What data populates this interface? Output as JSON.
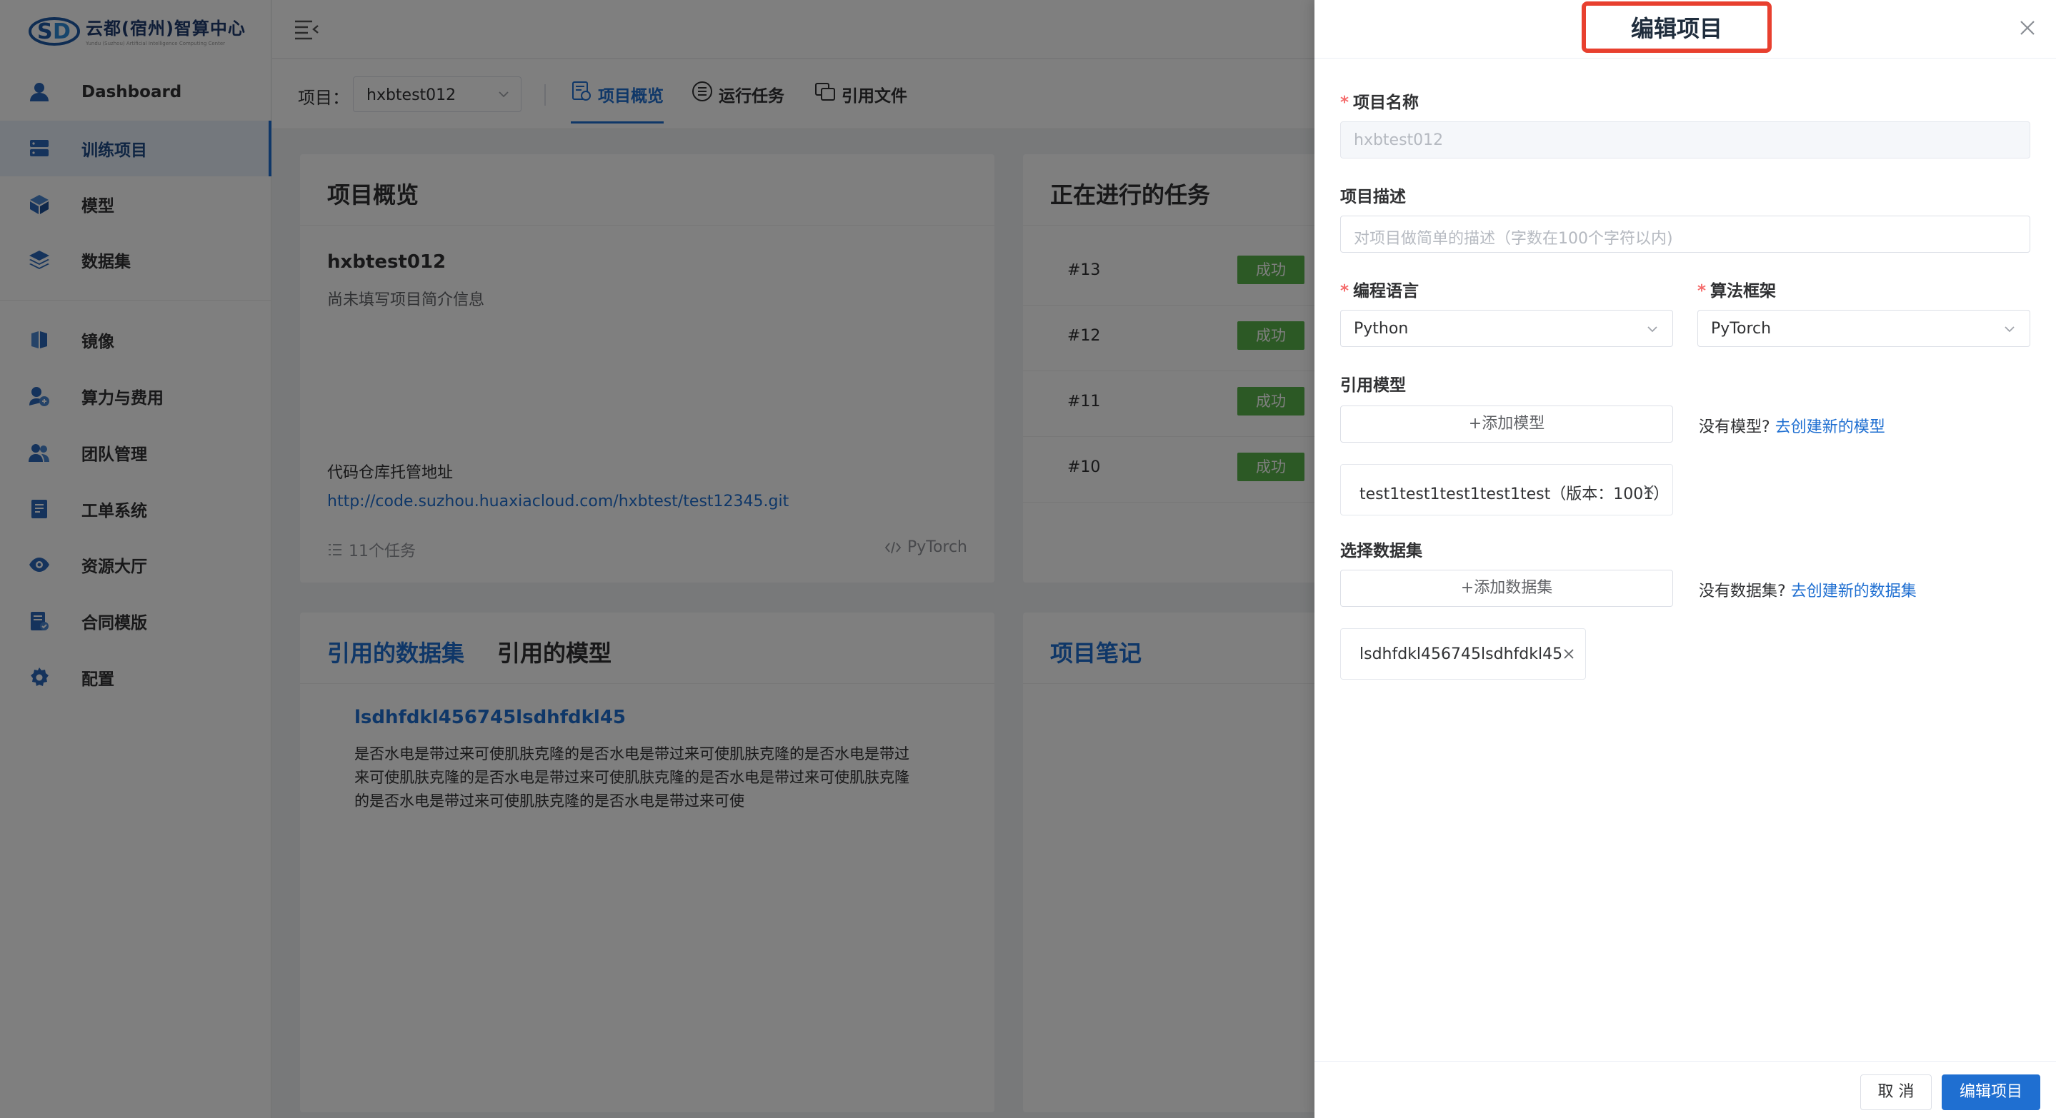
{
  "brand": {
    "title": "云都(宿州)智算中心",
    "subtitle": "Yundu (Suzhou) Artificial Intelligence Computing Center"
  },
  "sidebar": {
    "items": [
      {
        "label": "Dashboard",
        "icon": "user-icon"
      },
      {
        "label": "训练项目",
        "icon": "server-icon",
        "active": true
      },
      {
        "label": "模型",
        "icon": "cube-icon"
      },
      {
        "label": "数据集",
        "icon": "layers-icon"
      },
      {
        "label": "镜像",
        "icon": "image-icon"
      },
      {
        "label": "算力与费用",
        "icon": "cost-icon"
      },
      {
        "label": "团队管理",
        "icon": "team-icon"
      },
      {
        "label": "工单系统",
        "icon": "ticket-icon"
      },
      {
        "label": "资源大厅",
        "icon": "eye-icon"
      },
      {
        "label": "合同模版",
        "icon": "contract-icon"
      },
      {
        "label": "配置",
        "icon": "gear-icon"
      }
    ]
  },
  "project_bar": {
    "label": "项目：",
    "selected": "hxbtest012",
    "tabs": [
      {
        "label": "项目概览",
        "active": true
      },
      {
        "label": "运行任务"
      },
      {
        "label": "引用文件"
      }
    ]
  },
  "overview": {
    "title": "项目概览",
    "name": "hxbtest012",
    "desc": "尚未填写项目简介信息",
    "repo_label": "代码仓库托管地址",
    "repo_url": "http://code.suzhou.huaxiacloud.com/hxbtest/test12345.git",
    "task_count": "11个任务",
    "framework": "PyTorch"
  },
  "running": {
    "title": "正在进行的任务",
    "tasks": [
      {
        "id": "#13",
        "status": "成功"
      },
      {
        "id": "#12",
        "status": "成功"
      },
      {
        "id": "#11",
        "status": "成功"
      },
      {
        "id": "#10",
        "status": "成功"
      }
    ]
  },
  "refs": {
    "tab_datasets": "引用的数据集",
    "tab_models": "引用的模型",
    "dataset_name": "lsdhfdkl456745lsdhfdkl45",
    "dataset_desc": [
      "是否水电是带过来可使肌肤克隆的是否水电是带过来可使肌肤克隆的是否水电是带过",
      "来可使肌肤克隆的是否水电是带过来可使肌肤克隆的是否水电是带过来可使肌肤克隆",
      "的是否水电是带过来可使肌肤克隆的是否水电是带过来可使"
    ]
  },
  "notes": {
    "title": "项目笔记"
  },
  "drawer": {
    "title": "编辑项目",
    "name_label": "项目名称",
    "name_value": "hxbtest012",
    "desc_label": "项目描述",
    "desc_placeholder": "对项目做简单的描述（字数在100个字符以内)",
    "lang_label": "编程语言",
    "lang_value": "Python",
    "framework_label": "算法框架",
    "framework_value": "PyTorch",
    "model_label": "引用模型",
    "add_model": "+添加模型",
    "model_hint": "没有模型?",
    "model_link": "去创建新的模型",
    "model_tag": "test1test1test1test1test（版本：1001）",
    "dataset_label": "选择数据集",
    "add_dataset": "+添加数据集",
    "dataset_hint": "没有数据集?",
    "dataset_link": "去创建新的数据集",
    "dataset_tag": "lsdhfdkl456745lsdhfdkl45",
    "cancel": "取 消",
    "submit": "编辑项目"
  },
  "colors": {
    "primary": "#1f6fd1",
    "success": "#58b34a",
    "highlight": "#e8402f",
    "required": "#f56c6c"
  }
}
